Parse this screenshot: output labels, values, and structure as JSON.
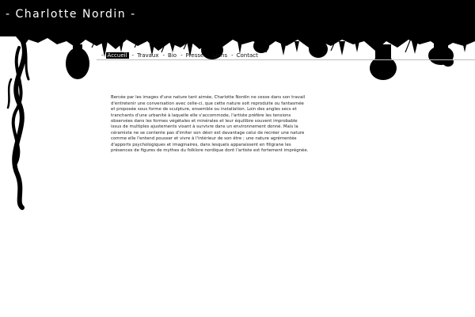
{
  "header": {
    "title": "- Charlotte Nordin -",
    "background_color": "#000000",
    "title_color": "#ffffff"
  },
  "nav": {
    "items": [
      {
        "label": "Accueil",
        "active": true
      },
      {
        "label": "Travaux",
        "active": false
      },
      {
        "label": "Bio",
        "active": false
      },
      {
        "label": "Presse",
        "active": false
      },
      {
        "label": "Liens",
        "active": false
      },
      {
        "label": "Contact",
        "active": false
      }
    ],
    "separator": "-"
  },
  "content": {
    "paragraph": "Bercée par les images d'une nature tant aimée, Charlotte Nordin ne cesse dans son travail d'entretenir une conversation avec celle-ci, que cette nature soit reproduite ou fantasmée et proposée sous forme de sculpture, ensemble ou installation. Loin des angles secs et tranchants d'une urbanité à laquelle elle s'accommode, l'artiste préfère les tensions observées dans les formes végétales et minérales et leur équilibre souvent improbable issus de multiples ajustements visant à survivre dans un environnement donné. Mais la céramiste ne se contente pas d'imiter son désir est davantage celui de recréer une nature comme elle l'entend pousser et vivre à l'intérieur de son être ; une nature agrémentée d'apports psychologiques et imaginaires, dans lesquels apparaissent en filigrane les présences de figures de mythes du folklore nordique dont l'artiste est fortement imprégnée."
  }
}
